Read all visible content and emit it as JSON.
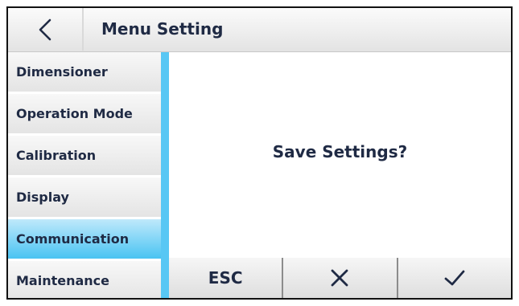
{
  "header": {
    "back_icon": "chevron-left-icon",
    "title": "Menu Setting"
  },
  "sidebar": {
    "items": [
      {
        "label": "Dimensioner",
        "selected": false
      },
      {
        "label": "Operation Mode",
        "selected": false
      },
      {
        "label": "Calibration",
        "selected": false
      },
      {
        "label": "Display",
        "selected": false
      },
      {
        "label": "Communication",
        "selected": true
      },
      {
        "label": "Maintenance",
        "selected": false
      }
    ]
  },
  "dialog": {
    "prompt": "Save Settings?"
  },
  "buttons": {
    "esc_label": "ESC",
    "cancel_icon": "x-icon",
    "confirm_icon": "check-icon"
  },
  "colors": {
    "accent": "#58c7f4",
    "selected_gradient_bottom": "#49c3f2",
    "text": "#1f2a44"
  }
}
